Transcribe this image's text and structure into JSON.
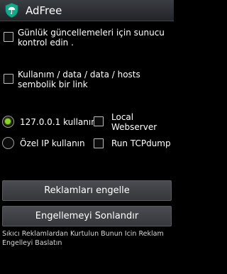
{
  "app_bar": {
    "title": "AdFree",
    "icon": "shield-umbrella-icon",
    "icon_color": "#16a88b"
  },
  "options": {
    "update_check": {
      "line1": "Günlük güncellemeleri için sunucu",
      "line2": "kontrol edin .",
      "checked": false
    },
    "symlink": {
      "line1": "Kullanım / data / data / hosts",
      "line2": "sembolik bir link",
      "checked": false
    },
    "use_localhost": {
      "label": "127.0.0.1 kullanın",
      "selected": true
    },
    "local_webserver": {
      "line1": "Local",
      "line2": "Webserver",
      "checked": false
    },
    "custom_ip": {
      "label": "Özel IP kullanın",
      "selected": false
    },
    "tcpdump": {
      "label": "Run TCPdump",
      "checked": false
    }
  },
  "buttons": {
    "block_ads": "Reklamları engelle",
    "stop_blocking": "Engellemeyi Sonlandır"
  },
  "footer": {
    "line1": "Sıkıcı Reklamlardan Kurtulun Bunun Icin Reklam",
    "line2": "Engelleyi Baslatın"
  },
  "colors": {
    "radio_accent": "#8cd61e",
    "background": "#000000"
  }
}
